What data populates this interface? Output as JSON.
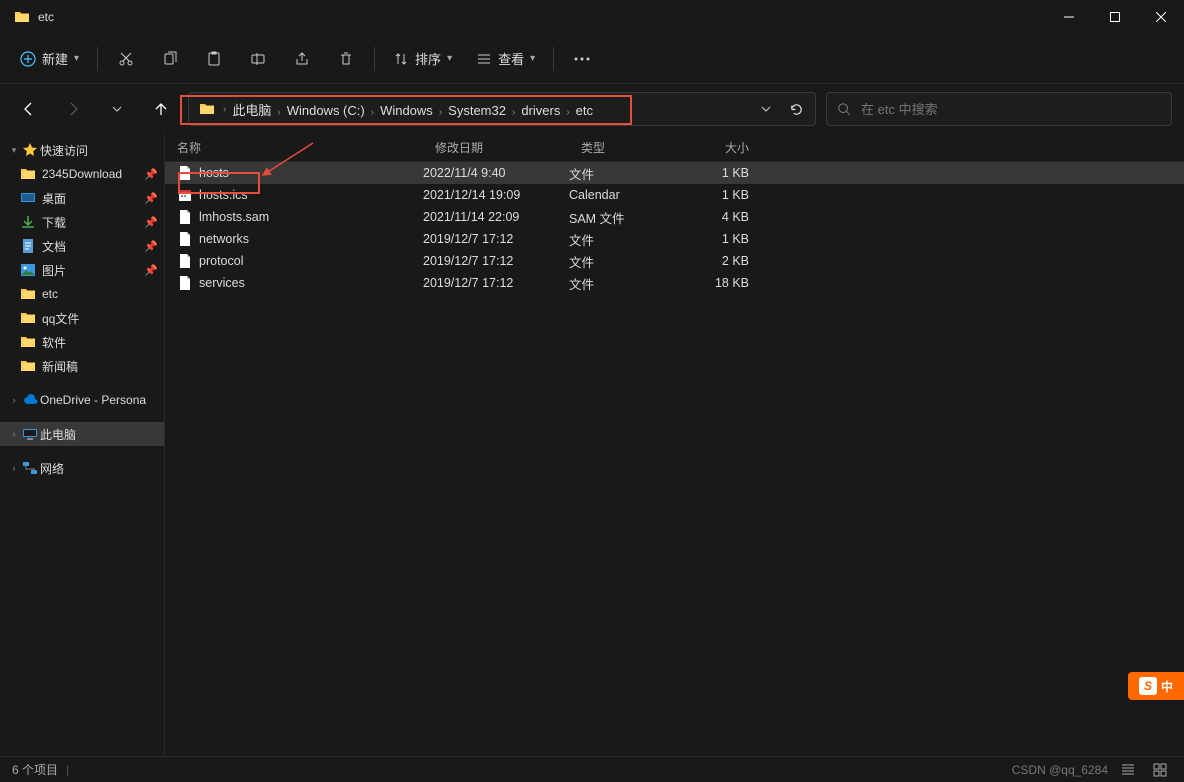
{
  "window": {
    "title": "etc"
  },
  "toolbar": {
    "new_label": "新建",
    "sort_label": "排序",
    "view_label": "查看"
  },
  "breadcrumbs": [
    "此电脑",
    "Windows (C:)",
    "Windows",
    "System32",
    "drivers",
    "etc"
  ],
  "search": {
    "placeholder": "在 etc 中搜索"
  },
  "sidebar": {
    "quick": "快速访问",
    "items": [
      {
        "label": "2345Download",
        "pinned": true,
        "icon": "folder"
      },
      {
        "label": "桌面",
        "pinned": true,
        "icon": "desktop"
      },
      {
        "label": "下载",
        "pinned": true,
        "icon": "download"
      },
      {
        "label": "文档",
        "pinned": true,
        "icon": "document"
      },
      {
        "label": "图片",
        "pinned": true,
        "icon": "picture"
      },
      {
        "label": "etc",
        "pinned": false,
        "icon": "folder"
      },
      {
        "label": "qq文件",
        "pinned": false,
        "icon": "folder"
      },
      {
        "label": "软件",
        "pinned": false,
        "icon": "folder"
      },
      {
        "label": "新闻稿",
        "pinned": false,
        "icon": "folder"
      }
    ],
    "onedrive": "OneDrive - Persona",
    "thispc": "此电脑",
    "network": "网络"
  },
  "columns": {
    "name": "名称",
    "date": "修改日期",
    "type": "类型",
    "size": "大小"
  },
  "files": [
    {
      "name": "hosts",
      "date": "2022/11/4 9:40",
      "type": "文件",
      "size": "1 KB",
      "selected": true
    },
    {
      "name": "hosts.ics",
      "date": "2021/12/14 19:09",
      "type": "Calendar",
      "size": "1 KB",
      "icon": "calendar"
    },
    {
      "name": "lmhosts.sam",
      "date": "2021/11/14 22:09",
      "type": "SAM 文件",
      "size": "4 KB"
    },
    {
      "name": "networks",
      "date": "2019/12/7 17:12",
      "type": "文件",
      "size": "1 KB"
    },
    {
      "name": "protocol",
      "date": "2019/12/7 17:12",
      "type": "文件",
      "size": "2 KB"
    },
    {
      "name": "services",
      "date": "2019/12/7 17:12",
      "type": "文件",
      "size": "18 KB"
    }
  ],
  "status": {
    "count": "6 个项目"
  },
  "watermark": "CSDN @qq_6284",
  "badge": {
    "s": "S",
    "txt": "中"
  }
}
